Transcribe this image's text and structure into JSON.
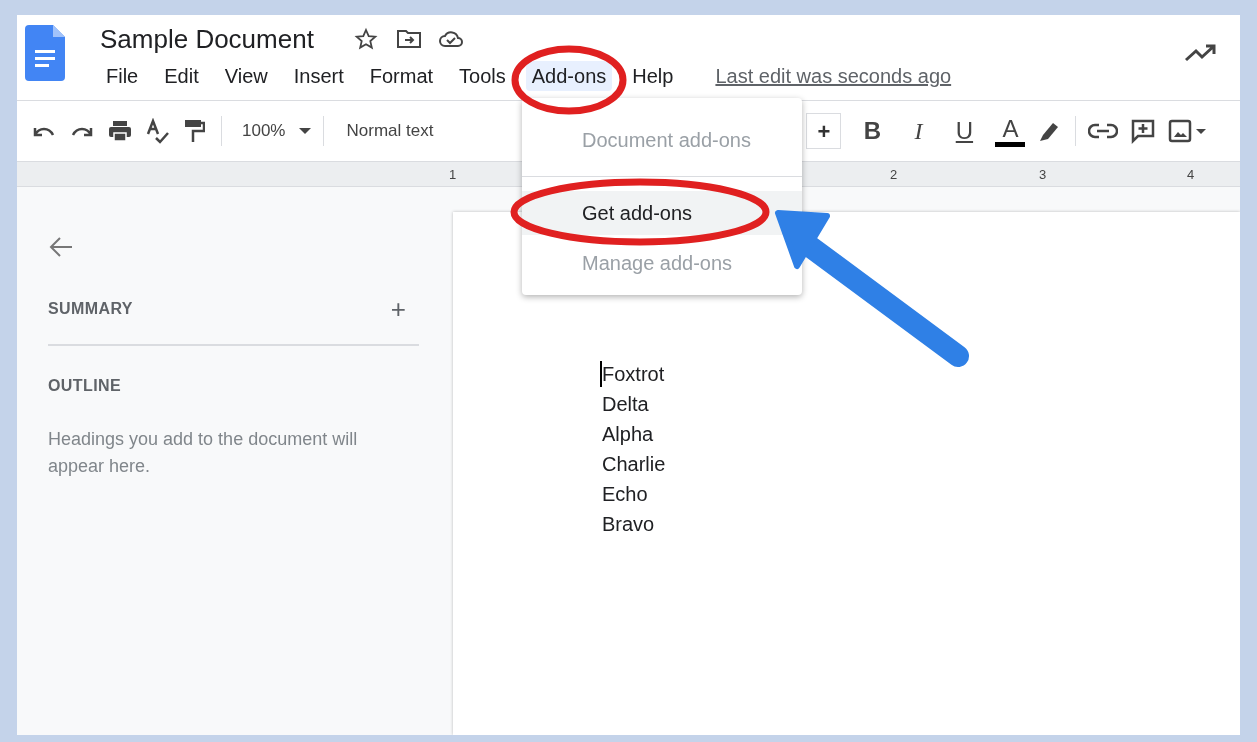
{
  "document": {
    "title": "Sample Document"
  },
  "menu": [
    {
      "label": "File",
      "selected": false
    },
    {
      "label": "Edit",
      "selected": false
    },
    {
      "label": "View",
      "selected": false
    },
    {
      "label": "Insert",
      "selected": false
    },
    {
      "label": "Format",
      "selected": false
    },
    {
      "label": "Tools",
      "selected": false
    },
    {
      "label": "Add-ons",
      "selected": true
    },
    {
      "label": "Help",
      "selected": false
    }
  ],
  "last_edit": "Last edit was seconds ago",
  "toolbar": {
    "zoom": "100%",
    "style": "Normal text",
    "size_increase": "+",
    "format_buttons": [
      "B",
      "I",
      "U",
      "A"
    ]
  },
  "ruler": [
    "1",
    "2",
    "3",
    "4"
  ],
  "dropdown": [
    {
      "label": "Document add-ons",
      "disabled": true,
      "selected": false
    },
    {
      "label": "Get add-ons",
      "disabled": false,
      "selected": true
    },
    {
      "label": "Manage add-ons",
      "disabled": true,
      "selected": false
    }
  ],
  "sidebar": {
    "summary": "SUMMARY",
    "add": "+",
    "outline": "OUTLINE",
    "hint": "Headings you add to the document will appear here."
  },
  "body_lines": [
    "Foxtrot",
    "Delta",
    "Alpha",
    "Charlie",
    "Echo",
    "Bravo"
  ]
}
